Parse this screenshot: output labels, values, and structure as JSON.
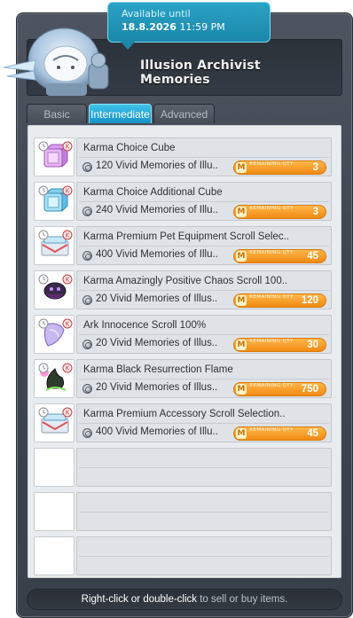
{
  "availability": {
    "label": "Available until",
    "date": "18.8.2026",
    "time": "11:59 PM"
  },
  "npc": {
    "title": "Illusion Archivist Memories"
  },
  "tabs": [
    {
      "label": "Basic",
      "active": false
    },
    {
      "label": "Intermediate",
      "active": true
    },
    {
      "label": "Advanced",
      "active": false
    }
  ],
  "remaining_label": "REMAINING QTY",
  "items": [
    {
      "name": "Karma Choice Cube",
      "cost": "120 Vivid Memories of Illu..",
      "remaining": "3",
      "icon": "pink-cube-icon"
    },
    {
      "name": "Karma Choice Additional Cube",
      "cost": "240 Vivid Memories of Illu..",
      "remaining": "3",
      "icon": "blue-cube-icon"
    },
    {
      "name": "Karma Premium Pet Equipment Scroll Selec..",
      "cost": "400 Vivid Memories of Illu..",
      "remaining": "45",
      "icon": "scroll-box-icon"
    },
    {
      "name": "Karma Amazingly Positive Chaos Scroll 100..",
      "cost": "20 Vivid Memories of Illus..",
      "remaining": "120",
      "icon": "chaos-scroll-icon"
    },
    {
      "name": "Ark Innocence Scroll 100%",
      "cost": "20 Vivid Memories of Illus..",
      "remaining": "30",
      "icon": "innocence-scroll-icon"
    },
    {
      "name": "Karma Black Resurrection Flame",
      "cost": "20 Vivid Memories of Illus..",
      "remaining": "750",
      "icon": "black-flame-icon"
    },
    {
      "name": "Karma Premium Accessory Scroll Selection..",
      "cost": "400 Vivid Memories of Illu..",
      "remaining": "45",
      "icon": "scroll-box-icon"
    }
  ],
  "footer": {
    "action": "Right-click or double-click",
    "rest": " to sell or buy items."
  },
  "colors": {
    "tab_active": "#1aa6d8",
    "remaining_badge": "#f39a1e",
    "tooltip": "#1f94b8"
  }
}
